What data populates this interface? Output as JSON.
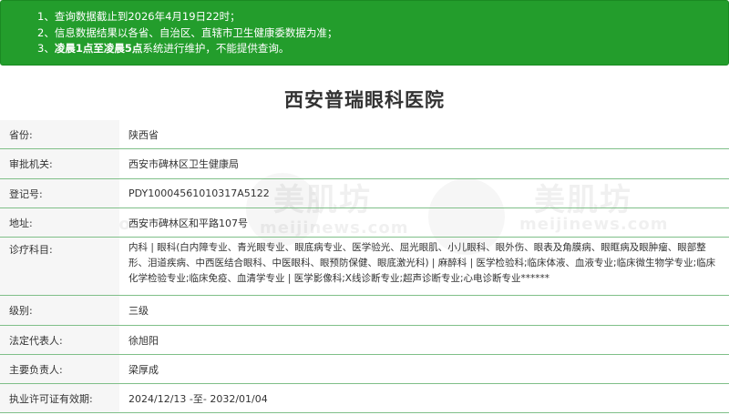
{
  "notice": {
    "line1": "1、查询数据截止到2026年4月19日22时；",
    "line2": "2、信息数据结果以各省、自治区、直辖市卫生健康委数据为准；",
    "line3_prefix": "3、",
    "line3_bold": "凌晨1点至凌晨5点",
    "line3_suffix": "系统进行维护，不能提供查询。"
  },
  "watermark": {
    "title": "美肌坊",
    "url": "meijinews.com"
  },
  "hospital_name": "西安普瑞眼科医院",
  "rows": [
    {
      "label": "省份:",
      "value": "陕西省"
    },
    {
      "label": "审批机关:",
      "value": "西安市碑林区卫生健康局"
    },
    {
      "label": "登记号:",
      "value": "PDY10004561010317A5122"
    },
    {
      "label": "地址:",
      "value": "西安市碑林区和平路107号"
    },
    {
      "label": "诊疗科目:",
      "value": "内科 | 眼科(白内障专业、青光眼专业、眼底病专业、医学验光、屈光眼肌、小儿眼科、眼外伤、眼表及角膜病、眼眶病及眼肿瘤、眼部整形、泪道疾病、中西医结合眼科、中医眼科、眼预防保健、眼底激光科) | 麻醉科 | 医学检验科;临床体液、血液专业;临床微生物学专业;临床化学检验专业;临床免疫、血清学专业 | 医学影像科;X线诊断专业;超声诊断专业;心电诊断专业******"
    },
    {
      "label": "级别:",
      "value": "三级"
    },
    {
      "label": "法定代表人:",
      "value": "徐旭阳"
    },
    {
      "label": "主要负责人:",
      "value": "梁厚成"
    },
    {
      "label": "执业许可证有效期:",
      "value": "2024/12/13 -至- 2032/01/04"
    }
  ]
}
